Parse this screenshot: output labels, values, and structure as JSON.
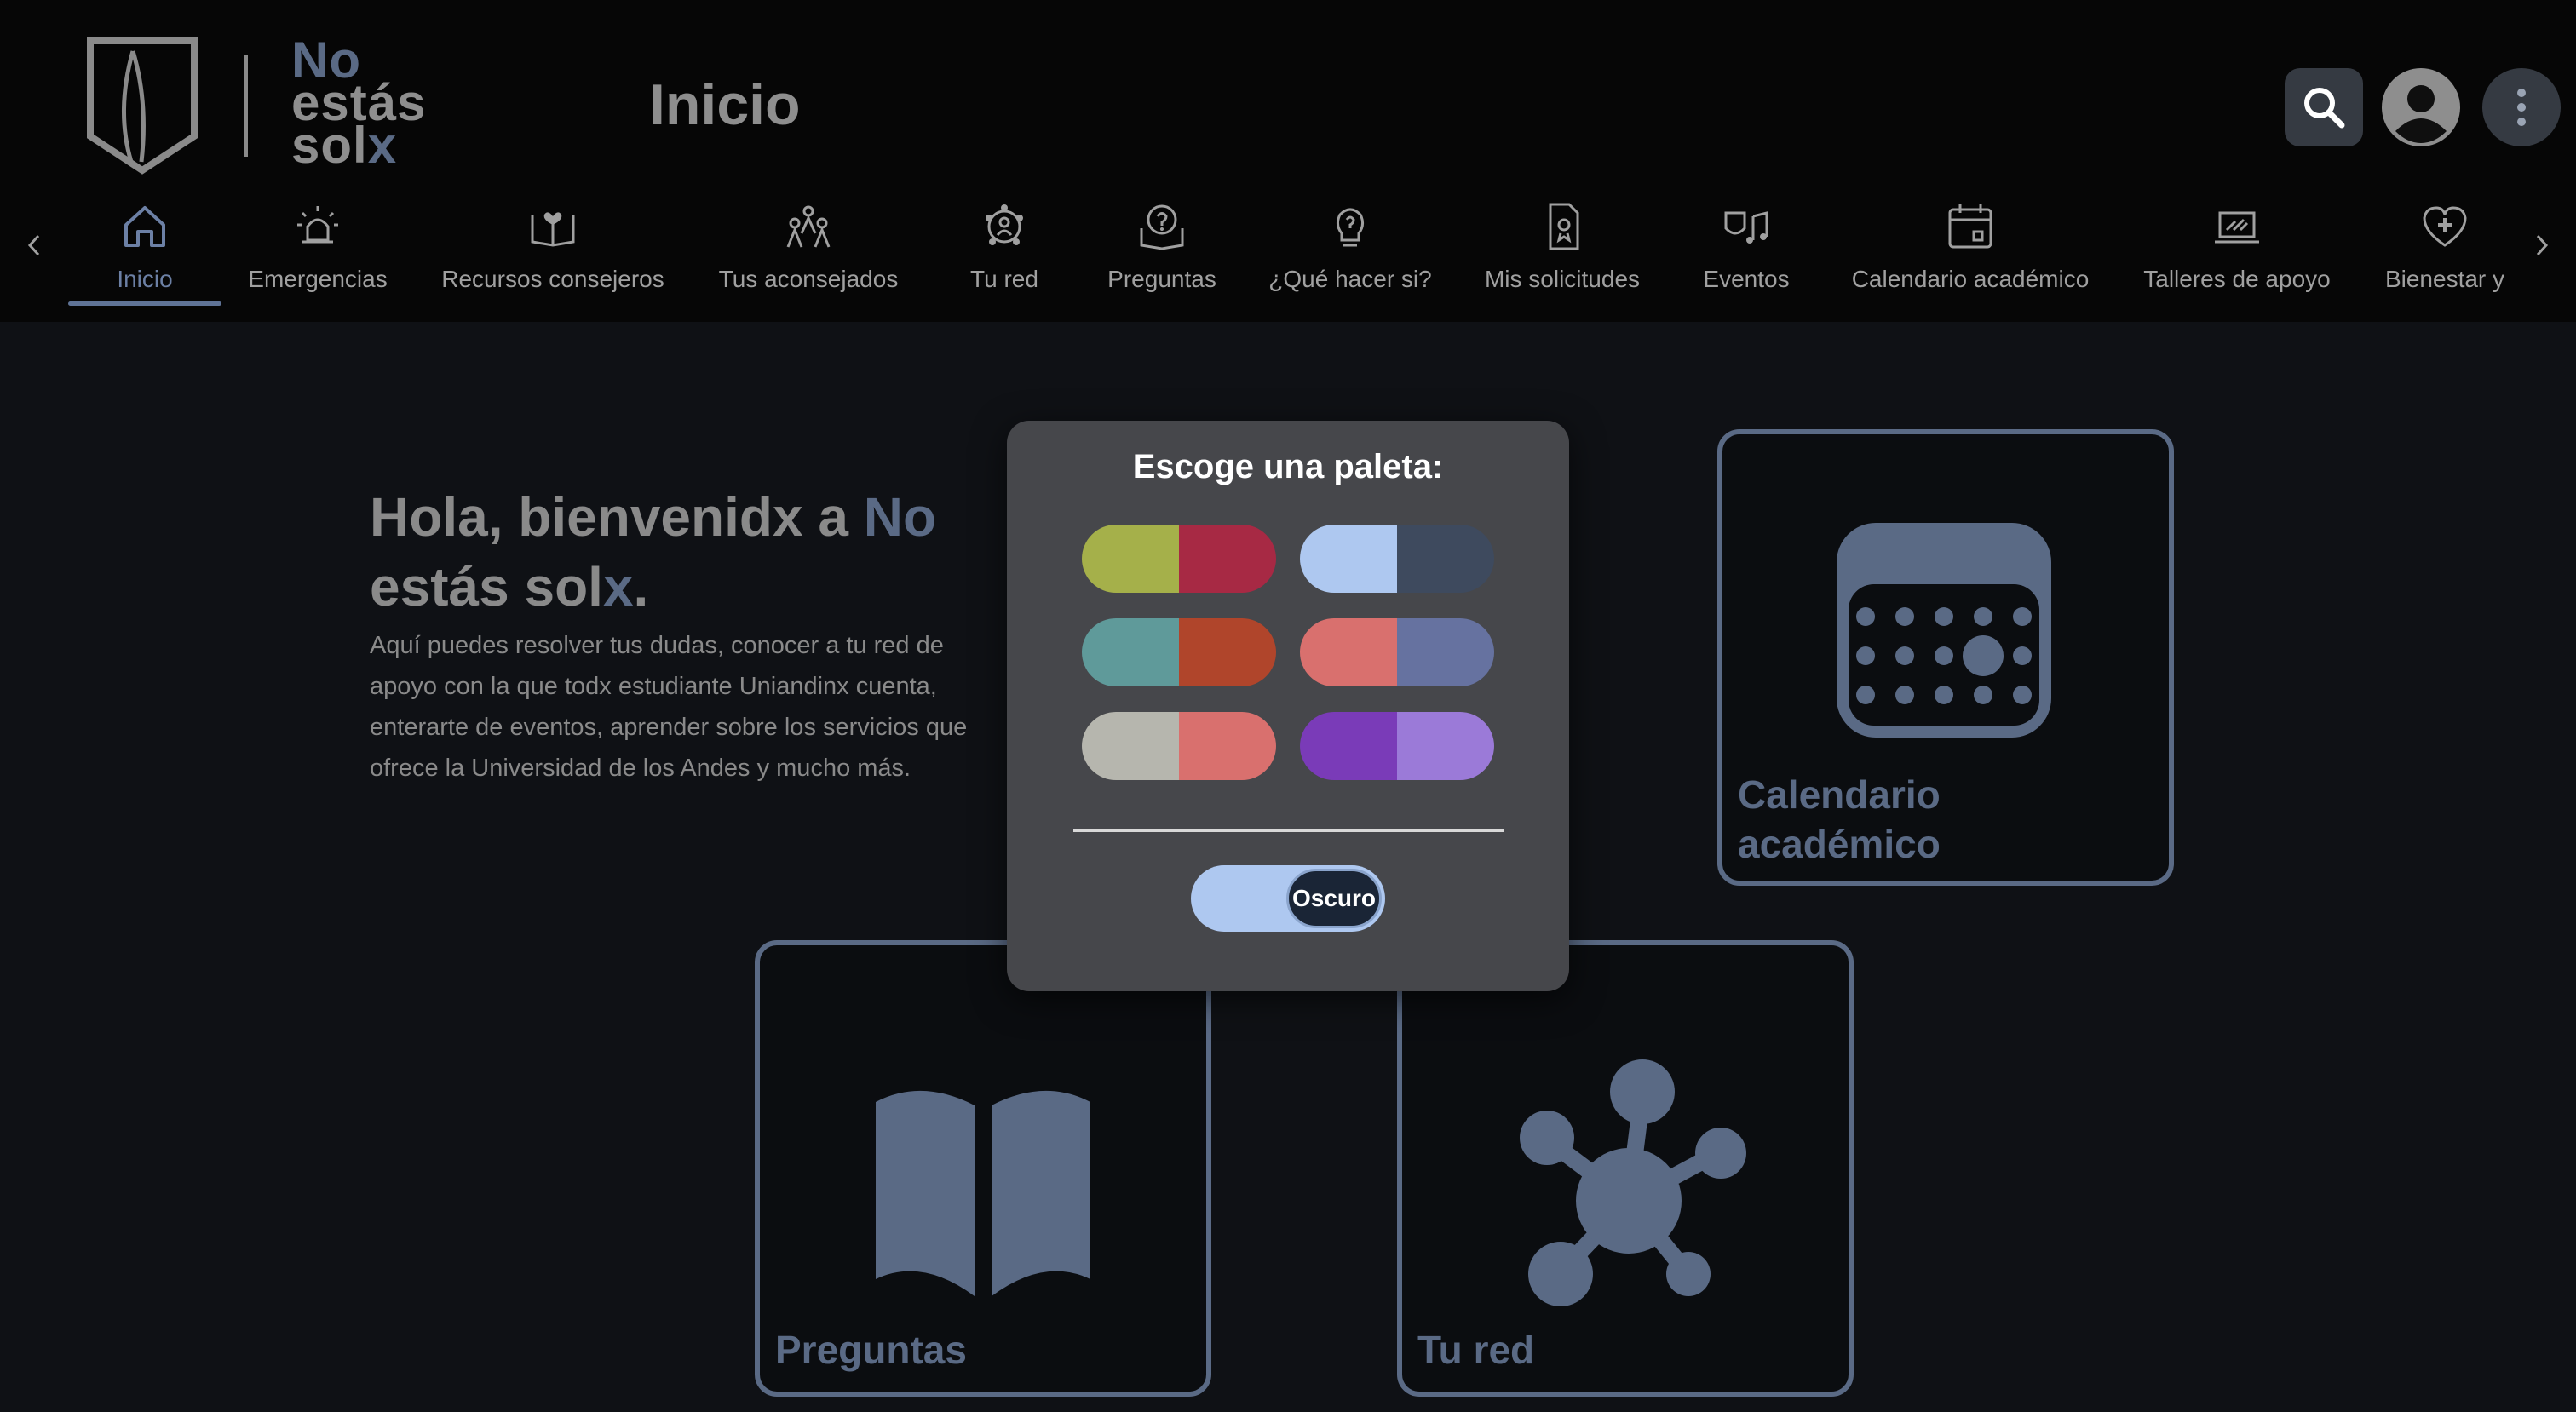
{
  "header": {
    "logo_line1": "No",
    "logo_line2": "estás",
    "logo_line3_a": "sol",
    "logo_line3_b": "x",
    "page_title": "Inicio",
    "search_icon": "search-icon",
    "avatar_icon": "user-avatar-icon",
    "more_icon": "more-vertical-icon"
  },
  "nav": {
    "items": [
      {
        "label": "Inicio",
        "icon": "home-icon"
      },
      {
        "label": "Emergencias",
        "icon": "alarm-light-icon"
      },
      {
        "label": "Recursos consejeros",
        "icon": "open-book-heart-icon"
      },
      {
        "label": "Tus aconsejados",
        "icon": "people-group-icon"
      },
      {
        "label": "Tu red",
        "icon": "network-person-icon"
      },
      {
        "label": "Preguntas",
        "icon": "question-book-icon"
      },
      {
        "label": "¿Qué hacer si?",
        "icon": "lightbulb-question-icon"
      },
      {
        "label": "Mis solicitudes",
        "icon": "document-request-icon"
      },
      {
        "label": "Eventos",
        "icon": "theater-music-icon"
      },
      {
        "label": "Calendario académico",
        "icon": "calendar-icon"
      },
      {
        "label": "Talleres de apoyo",
        "icon": "laptop-workshop-icon"
      },
      {
        "label": "Bienestar y",
        "icon": "heart-plus-icon"
      }
    ]
  },
  "main": {
    "welcome_title_a": "Hola, bienvenidx a ",
    "welcome_title_b": "No",
    "welcome_title_c": " estás sol",
    "welcome_title_d": "x",
    "welcome_title_e": ".",
    "welcome_text": "Aquí puedes resolver tus dudas, conocer a tu red de apoyo con la que todx estudiante Uniandinx cuenta, enterarte de eventos, aprender sobre los servicios que ofrece la Universidad de los Andes y mucho más.",
    "cards": {
      "calendar": "Calendario académico",
      "questions": "Preguntas",
      "network": "Tu red"
    }
  },
  "modal": {
    "title": "Escoge una paleta:",
    "palettes": [
      [
        "#a5b04a",
        "#a72944"
      ],
      [
        "#aec8f0",
        "#3e4a5e"
      ],
      [
        "#5f9a9a",
        "#b0452b"
      ],
      [
        "#d9706e",
        "#6672a0"
      ],
      [
        "#b6b6ae",
        "#d9706e"
      ],
      [
        "#7a3bb8",
        "#9b7ad8"
      ]
    ],
    "mode_label": "Oscuro"
  },
  "colors": {
    "accent": "#5a6a85",
    "background": "#0f1115",
    "header": "#060606",
    "modal": "#46474b"
  }
}
